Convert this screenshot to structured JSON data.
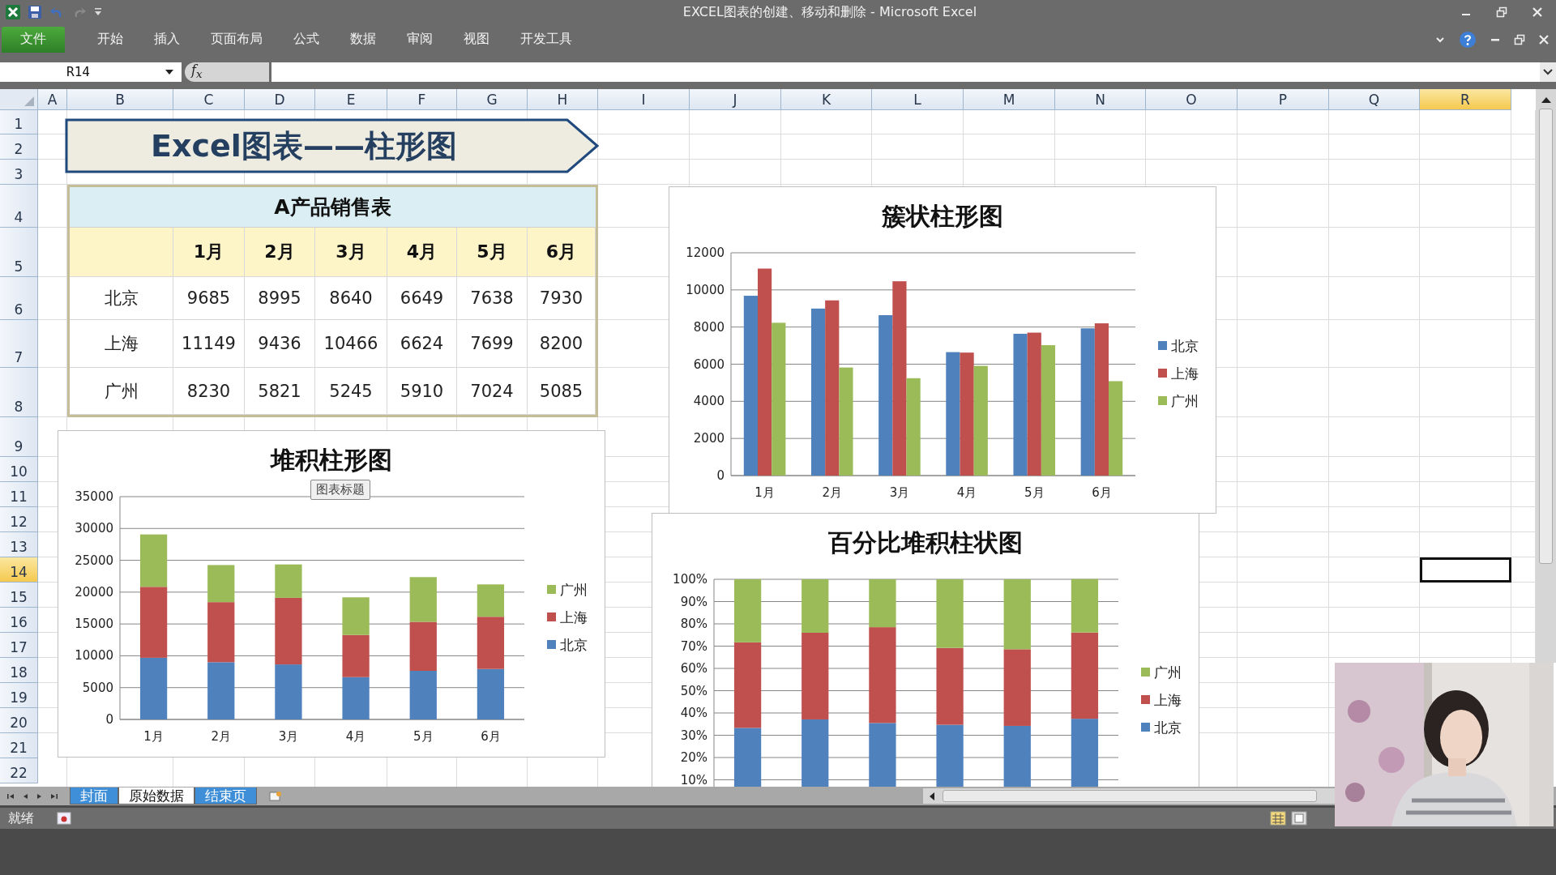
{
  "window": {
    "title": "EXCEL图表的创建、移动和删除 - Microsoft Excel"
  },
  "ribbon_tabs": [
    {
      "label": "文件",
      "kind": "file"
    },
    {
      "label": "开始",
      "kind": "tab"
    },
    {
      "label": "插入",
      "kind": "tab"
    },
    {
      "label": "页面布局",
      "kind": "tab"
    },
    {
      "label": "公式",
      "kind": "tab"
    },
    {
      "label": "数据",
      "kind": "tab"
    },
    {
      "label": "审阅",
      "kind": "tab"
    },
    {
      "label": "视图",
      "kind": "tab"
    },
    {
      "label": "开发工具",
      "kind": "tab"
    }
  ],
  "name_box": {
    "value": "R14"
  },
  "formula_bar": {
    "function_label": "f$_{x}$"
  },
  "sheet": {
    "columns": [
      {
        "label": "A",
        "selected": false
      },
      {
        "label": "B",
        "selected": false
      },
      {
        "label": "C",
        "selected": false
      },
      {
        "label": "D",
        "selected": false
      },
      {
        "label": "E",
        "selected": false
      },
      {
        "label": "F",
        "selected": false
      },
      {
        "label": "G",
        "selected": false
      },
      {
        "label": "H",
        "selected": false
      },
      {
        "label": "I",
        "selected": false
      },
      {
        "label": "J",
        "selected": false
      },
      {
        "label": "K",
        "selected": false
      },
      {
        "label": "L",
        "selected": false
      },
      {
        "label": "M",
        "selected": false
      },
      {
        "label": "N",
        "selected": false
      },
      {
        "label": "O",
        "selected": false
      },
      {
        "label": "P",
        "selected": false
      },
      {
        "label": "Q",
        "selected": false
      },
      {
        "label": "R",
        "selected": true
      }
    ],
    "rows": [
      {
        "label": "1",
        "selected": false
      },
      {
        "label": "2",
        "selected": false
      },
      {
        "label": "3",
        "selected": false
      },
      {
        "label": "4",
        "selected": false
      },
      {
        "label": "5",
        "selected": false
      },
      {
        "label": "6",
        "selected": false
      },
      {
        "label": "7",
        "selected": false
      },
      {
        "label": "8",
        "selected": false
      },
      {
        "label": "9",
        "selected": false
      },
      {
        "label": "10",
        "selected": false
      },
      {
        "label": "11",
        "selected": false
      },
      {
        "label": "12",
        "selected": false
      },
      {
        "label": "13",
        "selected": false
      },
      {
        "label": "14",
        "selected": true
      },
      {
        "label": "15",
        "selected": false
      },
      {
        "label": "16",
        "selected": false
      },
      {
        "label": "17",
        "selected": false
      },
      {
        "label": "18",
        "selected": false
      },
      {
        "label": "19",
        "selected": false
      },
      {
        "label": "20",
        "selected": false
      },
      {
        "label": "21",
        "selected": false
      },
      {
        "label": "22",
        "selected": false
      }
    ]
  },
  "banner": {
    "text": "Excel图表——柱形图"
  },
  "sales_table": {
    "title": "A产品销售表",
    "columns": [
      "1月",
      "2月",
      "3月",
      "4月",
      "5月",
      "6月"
    ],
    "rows": [
      {
        "label": "北京",
        "values": [
          "9685",
          "8995",
          "8640",
          "6649",
          "7638",
          "7930"
        ]
      },
      {
        "label": "上海",
        "values": [
          "11149",
          "9436",
          "10466",
          "6624",
          "7699",
          "8200"
        ]
      },
      {
        "label": "广州",
        "values": [
          "8230",
          "5821",
          "5245",
          "5910",
          "7024",
          "5085"
        ]
      }
    ]
  },
  "charts": [
    {
      "chart_data": {
        "type": "bar",
        "title": "簇状柱形图",
        "categories": [
          "1月",
          "2月",
          "3月",
          "4月",
          "5月",
          "6月"
        ],
        "stacked": false,
        "grid": true,
        "legend": true,
        "ylim": [
          0,
          12000
        ],
        "yticks": [
          0,
          2000,
          4000,
          6000,
          8000,
          10000,
          12000
        ],
        "series": [
          {
            "name": "北京",
            "color": "#4f81bd",
            "values": [
              9685,
              8995,
              8640,
              6649,
              7638,
              7930
            ]
          },
          {
            "name": "上海",
            "color": "#c0504d",
            "values": [
              11149,
              9436,
              10466,
              6624,
              7699,
              8200
            ]
          },
          {
            "name": "广州",
            "color": "#9bbb59",
            "values": [
              8230,
              5821,
              5245,
              5910,
              7024,
              5085
            ]
          }
        ]
      }
    },
    {
      "tooltip": "图表标题",
      "chart_data": {
        "type": "bar",
        "title": "堆积柱形图",
        "categories": [
          "1月",
          "2月",
          "3月",
          "4月",
          "5月",
          "6月"
        ],
        "stacked": true,
        "grid": true,
        "legend": true,
        "ylim": [
          0,
          35000
        ],
        "yticks": [
          0,
          5000,
          10000,
          15000,
          20000,
          25000,
          30000,
          35000
        ],
        "series": [
          {
            "name": "北京",
            "color": "#4f81bd",
            "values": [
              9685,
              8995,
              8640,
              6649,
              7638,
              7930
            ]
          },
          {
            "name": "上海",
            "color": "#c0504d",
            "values": [
              11149,
              9436,
              10466,
              6624,
              7699,
              8200
            ]
          },
          {
            "name": "广州",
            "color": "#9bbb59",
            "values": [
              8230,
              5821,
              5245,
              5910,
              7024,
              5085
            ]
          }
        ]
      }
    },
    {
      "chart_data": {
        "type": "bar",
        "title": "百分比堆积柱状图",
        "stacked": true,
        "grid": true,
        "legend": true,
        "ylim": [
          0,
          100
        ],
        "yticks": [
          {
            "value": 10,
            "label": "10%"
          },
          {
            "value": 20,
            "label": "20%"
          },
          {
            "value": 30,
            "label": "30%"
          },
          {
            "value": 40,
            "label": "40%"
          },
          {
            "value": 50,
            "label": "50%"
          },
          {
            "value": 60,
            "label": "60%"
          },
          {
            "value": 70,
            "label": "70%"
          },
          {
            "value": 80,
            "label": "80%"
          },
          {
            "value": 90,
            "label": "90%"
          },
          {
            "value": 100,
            "label": "100%"
          }
        ],
        "series": [
          {
            "name": "北京",
            "color": "#4f81bd",
            "values": [
              33.3,
              37.1,
              35.5,
              34.7,
              34.2,
              37.4
            ]
          },
          {
            "name": "上海",
            "color": "#c0504d",
            "values": [
              38.4,
              38.9,
              43.0,
              34.5,
              34.4,
              38.7
            ]
          },
          {
            "name": "广州",
            "color": "#9bbb59",
            "values": [
              28.3,
              24.0,
              21.5,
              30.8,
              31.4,
              24.0
            ]
          }
        ]
      }
    }
  ],
  "sheet_tabs": [
    {
      "label": "封面",
      "selected": false
    },
    {
      "label": "原始数据",
      "selected": true
    },
    {
      "label": "结束页",
      "selected": false
    }
  ],
  "status_bar": {
    "text": "就绪"
  }
}
